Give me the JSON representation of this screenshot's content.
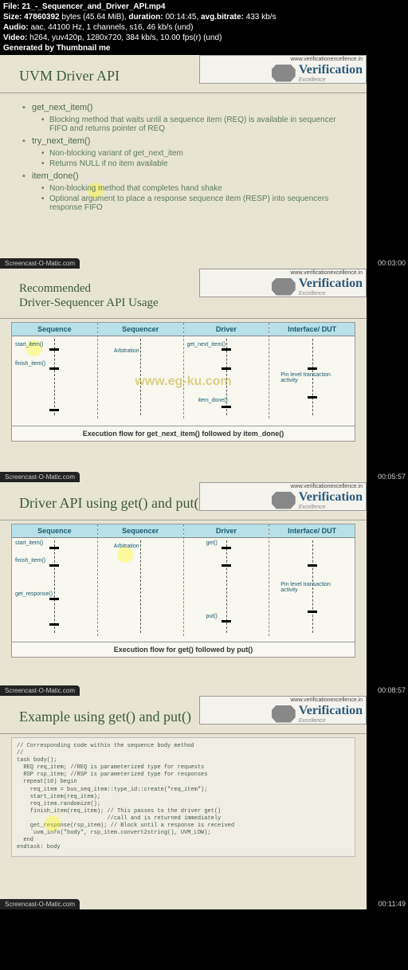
{
  "header": {
    "file_label": "File:",
    "file": "21_-_Sequencer_and_Driver_API.mp4",
    "size_label": "Size:",
    "size_bytes": "47860392",
    "size_bytes_unit": "bytes",
    "size_mib": "(45.64 MiB),",
    "duration_label": "duration:",
    "duration": "00:14:45,",
    "avgbitrate_label": "avg.bitrate:",
    "avgbitrate": "433 kb/s",
    "audio_label": "Audio:",
    "audio": "aac, 44100 Hz, 1 channels, s16, 46 kb/s (und)",
    "video_label": "Video:",
    "video": "h264, yuv420p, 1280x720, 384 kb/s, 10.00 fps(r) (und)",
    "generated": "Generated by Thumbnail me"
  },
  "brand": {
    "url": "www.verificationexcellence.in",
    "name": "Verification",
    "sub": "Excellence"
  },
  "som": "Screencast-O-Matic.com",
  "timestamps": [
    "00:03:00",
    "00:05:57",
    "00:08:57",
    "00:11:49"
  ],
  "slide1": {
    "title": "UVM Driver API",
    "b1": "get_next_item()",
    "b1s1": "Blocking method that waits until a sequence item (REQ) is available in sequencer FIFO and returns pointer of REQ",
    "b2": "try_next_item()",
    "b2s1": "Non-blocking variant of get_next_item",
    "b2s2": "Returns NULL if no item available",
    "b3": "item_done()",
    "b3s1": "Non-blocking method that completes hand shake",
    "b3s2": "Optional argument to place a response sequence item (RESP) into sequencers response FIFO"
  },
  "slide2": {
    "title_l1": "Recommended",
    "title_l2": "Driver-Sequencer API Usage",
    "cols": [
      "Sequence",
      "Sequencer",
      "Driver",
      "Interface/ DUT"
    ],
    "labels": {
      "start_item": "start_item()",
      "arbitration": "Arbitration",
      "get_next_item": "get_next_item()",
      "finish_item": "finish_item()",
      "pin_level": "Pin level transaction activity",
      "item_done": "item_done()"
    },
    "caption": "Execution flow for get_next_item() followed by item_done()",
    "watermark": "www.eg-ku.com"
  },
  "slide3": {
    "title": "Driver API using get() and put()",
    "cols": [
      "Sequence",
      "Sequencer",
      "Driver",
      "Interface/ DUT"
    ],
    "labels": {
      "start_item": "start_item()",
      "arbitration": "Arbitration",
      "get": "get()",
      "finish_item": "finish_item()",
      "get_response": "get_response()",
      "pin_level": "Pin level transaction activity",
      "put": "put()"
    },
    "caption": "Execution flow for get() followed by put()"
  },
  "slide4": {
    "title": "Example using get() and put()",
    "code": "// Corresponding code within the sequence body method\n//\ntask body();\n  REQ req_item; //REQ is parameterized type for requests\n  RSP rsp_item; //RSP is parameterized type for responses\n  repeat(10) begin\n    req_item = bus_seq_item::type_id::create(\"req_item\");\n    start_item(req_item);\n    req_item.randomize();\n    finish_item(req_item); // This passes to the driver get()\n                           //call and is returned immediately\n    get_response(rsp_item); // Block until a response is received\n    `uvm_info(\"body\", rsp_item.convert2string(), UVM_LOW);\n  end\nendtask: body"
  }
}
